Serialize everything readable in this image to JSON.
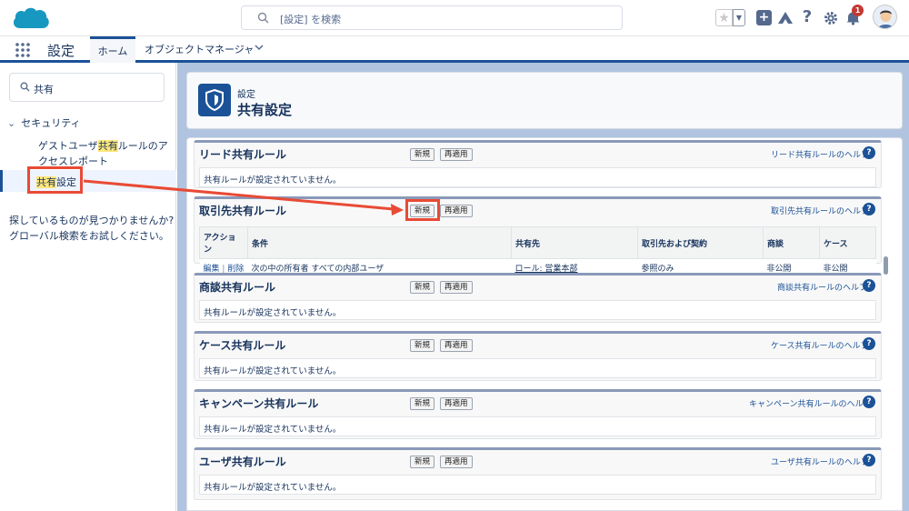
{
  "header": {
    "search_placeholder": "[設定] を検索",
    "notification_count": "1",
    "help_glyph": "?"
  },
  "appnav": {
    "app_name": "設定",
    "tabs": [
      {
        "label": "ホーム"
      },
      {
        "label": "オブジェクトマネージャ"
      }
    ]
  },
  "sidebar": {
    "quickfind_value": "共有",
    "section_label": "セキュリティ",
    "items": [
      {
        "pre": "ゲストユーザ",
        "hl": "共有",
        "post": "ルールのアクセスレポート"
      },
      {
        "hl": "共有",
        "post": "設定"
      }
    ],
    "help_text_1": "探しているものが見つかりませんか?",
    "help_text_2": "グローバル検索をお試しください。"
  },
  "page_header": {
    "breadcrumb": "設定",
    "title": "共有設定"
  },
  "sections": [
    {
      "title": "リード共有ルール",
      "new": "新規",
      "reapply": "再適用",
      "help": "リード共有ルールのヘルプ",
      "empty": "共有ルールが設定されていません。"
    },
    {
      "title": "取引先共有ルール",
      "new": "新規",
      "reapply": "再適用",
      "help": "取引先共有ルールのヘルプ",
      "columns": [
        "アクション",
        "条件",
        "共有先",
        "取引先および契約",
        "商談",
        "ケース"
      ],
      "rows": [
        {
          "edit": "編集",
          "sep": "|",
          "delete": "削除",
          "condition": "次の中の所有者 すべての内部ユーザ",
          "share_to": "ロール: 営業本部",
          "account_access": "参照のみ",
          "opportunity": "非公開",
          "case": "非公開"
        }
      ]
    },
    {
      "title": "商談共有ルール",
      "new": "新規",
      "reapply": "再適用",
      "help": "商談共有ルールのヘルプ",
      "empty": "共有ルールが設定されていません。"
    },
    {
      "title": "ケース共有ルール",
      "new": "新規",
      "reapply": "再適用",
      "help": "ケース共有ルールのヘルプ",
      "empty": "共有ルールが設定されていません。"
    },
    {
      "title": "キャンペーン共有ルール",
      "new": "新規",
      "reapply": "再適用",
      "help": "キャンペーン共有ルールのヘルプ",
      "empty": "共有ルールが設定されていません。"
    },
    {
      "title": "ユーザ共有ルール",
      "new": "新規",
      "reapply": "再適用",
      "help": "ユーザ共有ルールのヘルプ",
      "empty": "共有ルールが設定されていません。"
    }
  ],
  "colors": {
    "brand": "#1b5297",
    "annotation": "#e94a35",
    "highlight": "#ffe67a",
    "background": "#b0c4df"
  }
}
